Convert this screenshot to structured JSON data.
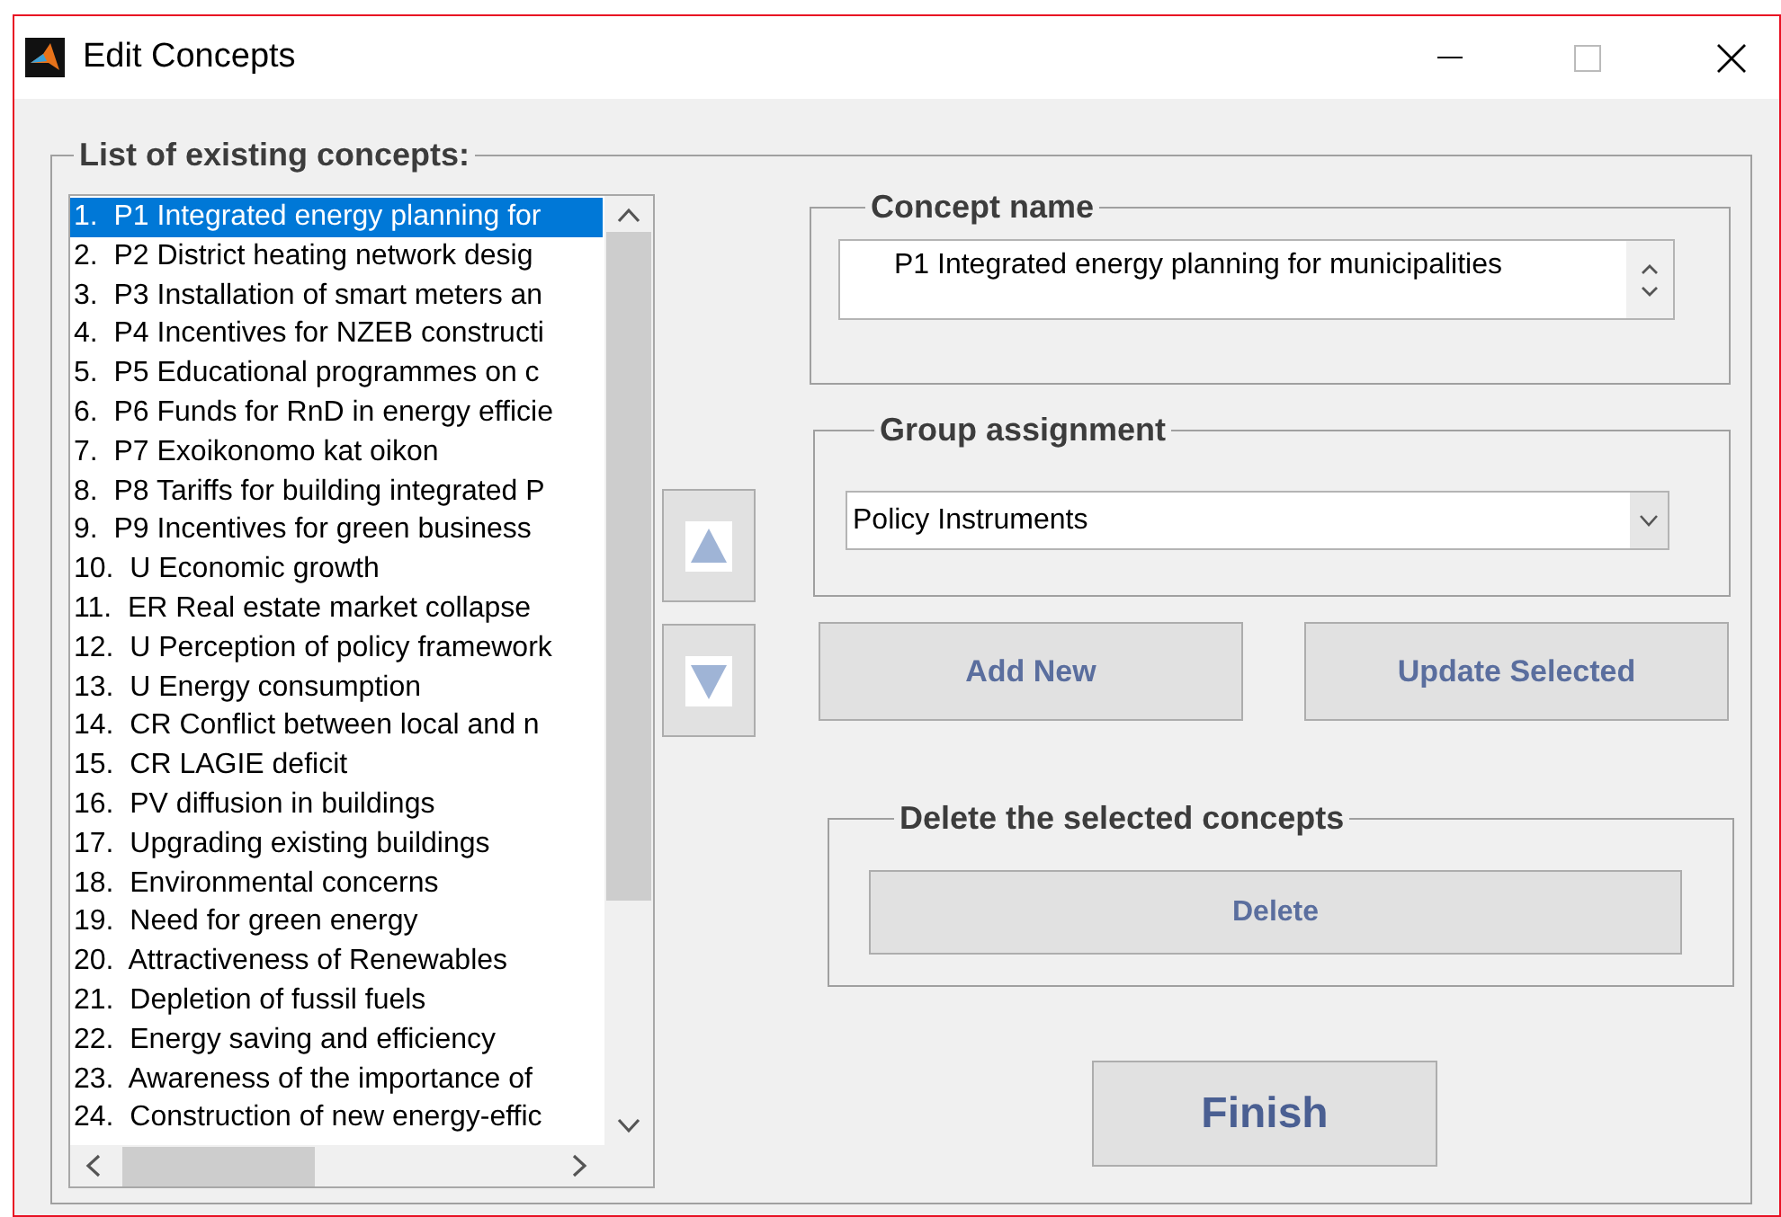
{
  "window": {
    "title": "Edit Concepts"
  },
  "concept_list": {
    "label": "List of existing concepts:",
    "items": [
      {
        "text": "1.  P1 Integrated energy planning for",
        "selected": true
      },
      {
        "text": "2.  P2 District heating network desig",
        "selected": false
      },
      {
        "text": "3.  P3 Installation of smart meters an",
        "selected": false
      },
      {
        "text": "4.  P4 Incentives for NZEB constructi",
        "selected": false
      },
      {
        "text": "5.  P5 Educational programmes on c",
        "selected": false
      },
      {
        "text": "6.  P6 Funds for RnD in energy efficie",
        "selected": false
      },
      {
        "text": "7.  P7 Exoikonomo kat oikon",
        "selected": false
      },
      {
        "text": "8.  P8 Tariffs for building integrated P",
        "selected": false
      },
      {
        "text": "9.  P9 Incentives for green business",
        "selected": false
      },
      {
        "text": "10.  U Economic growth",
        "selected": false
      },
      {
        "text": "11.  ER Real estate market collapse",
        "selected": false
      },
      {
        "text": "12.  U Perception of policy framework",
        "selected": false
      },
      {
        "text": "13.  U Energy consumption",
        "selected": false
      },
      {
        "text": "14.  CR Conflict between local and n",
        "selected": false
      },
      {
        "text": "15.  CR LAGIE deficit",
        "selected": false
      },
      {
        "text": "16.  PV diffusion in buildings",
        "selected": false
      },
      {
        "text": "17.  Upgrading existing buildings",
        "selected": false
      },
      {
        "text": "18.  Environmental concerns",
        "selected": false
      },
      {
        "text": "19.  Need for green energy",
        "selected": false
      },
      {
        "text": "20.  Attractiveness of Renewables",
        "selected": false
      },
      {
        "text": "21.  Depletion of fussil fuels",
        "selected": false
      },
      {
        "text": "22.  Energy saving and efficiency",
        "selected": false
      },
      {
        "text": "23.  Awareness of the importance of",
        "selected": false
      },
      {
        "text": "24.  Construction of new energy-effic",
        "selected": false
      }
    ]
  },
  "concept_name": {
    "label": "Concept name",
    "value": "P1 Integrated energy planning for municipalities"
  },
  "group_assignment": {
    "label": "Group assignment",
    "value": "Policy Instruments"
  },
  "buttons": [
    "Add New",
    "Update Selected"
  ],
  "delete_group": {
    "label": "Delete the selected concepts",
    "button": "Delete"
  },
  "finish": "Finish"
}
